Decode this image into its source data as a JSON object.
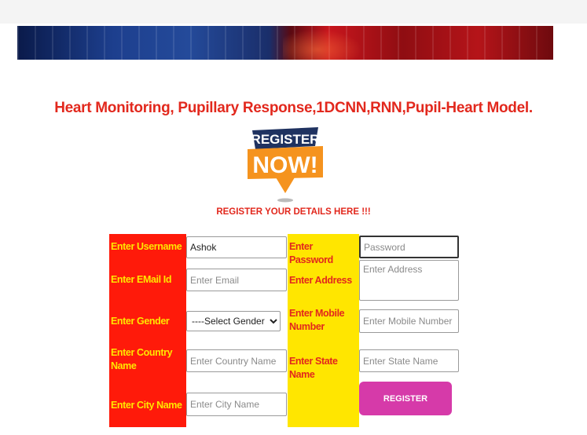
{
  "header": {
    "title": "Heart Monitoring, Pupillary Response,1DCNN,RNN,Pupil-Heart Model.",
    "logo_line1": "REGISTER",
    "logo_line2": "NOW!",
    "subtitle": "REGISTER YOUR DETAILS HERE !!!"
  },
  "form": {
    "username_label": "Enter Username",
    "username_value": "Ashok",
    "password_label": "Enter Password",
    "password_placeholder": "Password",
    "email_label": "Enter EMail Id",
    "email_placeholder": "Enter Email",
    "address_label": "Enter Address",
    "address_placeholder": "Enter Address",
    "gender_label": "Enter Gender",
    "gender_selected": "----Select Gender ----",
    "mobile_label": "Enter Mobile Number",
    "mobile_placeholder": "Enter Mobile Number",
    "country_label": "Enter Country Name",
    "country_placeholder": "Enter Country Name",
    "state_label": "Enter State Name",
    "state_placeholder": "Enter State Name",
    "city_label": "Enter City Name",
    "city_placeholder": "Enter City Name",
    "submit_label": "REGISTER"
  },
  "colors": {
    "title_red": "#e2281d",
    "label_column_red": "#ff1a0a",
    "label_column_yellow": "#ffe600",
    "button_magenta": "#d63aa9",
    "logo_orange": "#f5931e",
    "logo_navy": "#1f3260"
  }
}
